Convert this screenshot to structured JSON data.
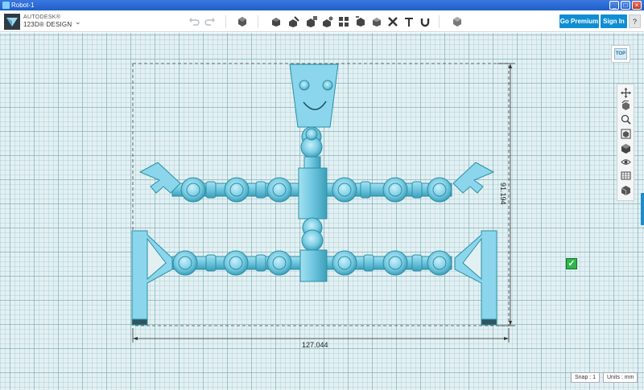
{
  "window": {
    "title": "Robot-1"
  },
  "logo": {
    "line1": "AUTODESK®",
    "line2": "123D® DESIGN"
  },
  "toolbar": {
    "premium_label": "Go Premium",
    "signin_label": "Sign In",
    "help_label": "?"
  },
  "viewcube": {
    "face": "TOP"
  },
  "dimensions": {
    "width": "127.044",
    "height": "91.194"
  },
  "status": {
    "snap": "Snap : 1",
    "units": "Units : mm"
  },
  "colors": {
    "accent": "#0f8ed3",
    "model": "#7fd3ea",
    "model_edge": "#2b8fa5",
    "grid": "#e3f0f2"
  }
}
